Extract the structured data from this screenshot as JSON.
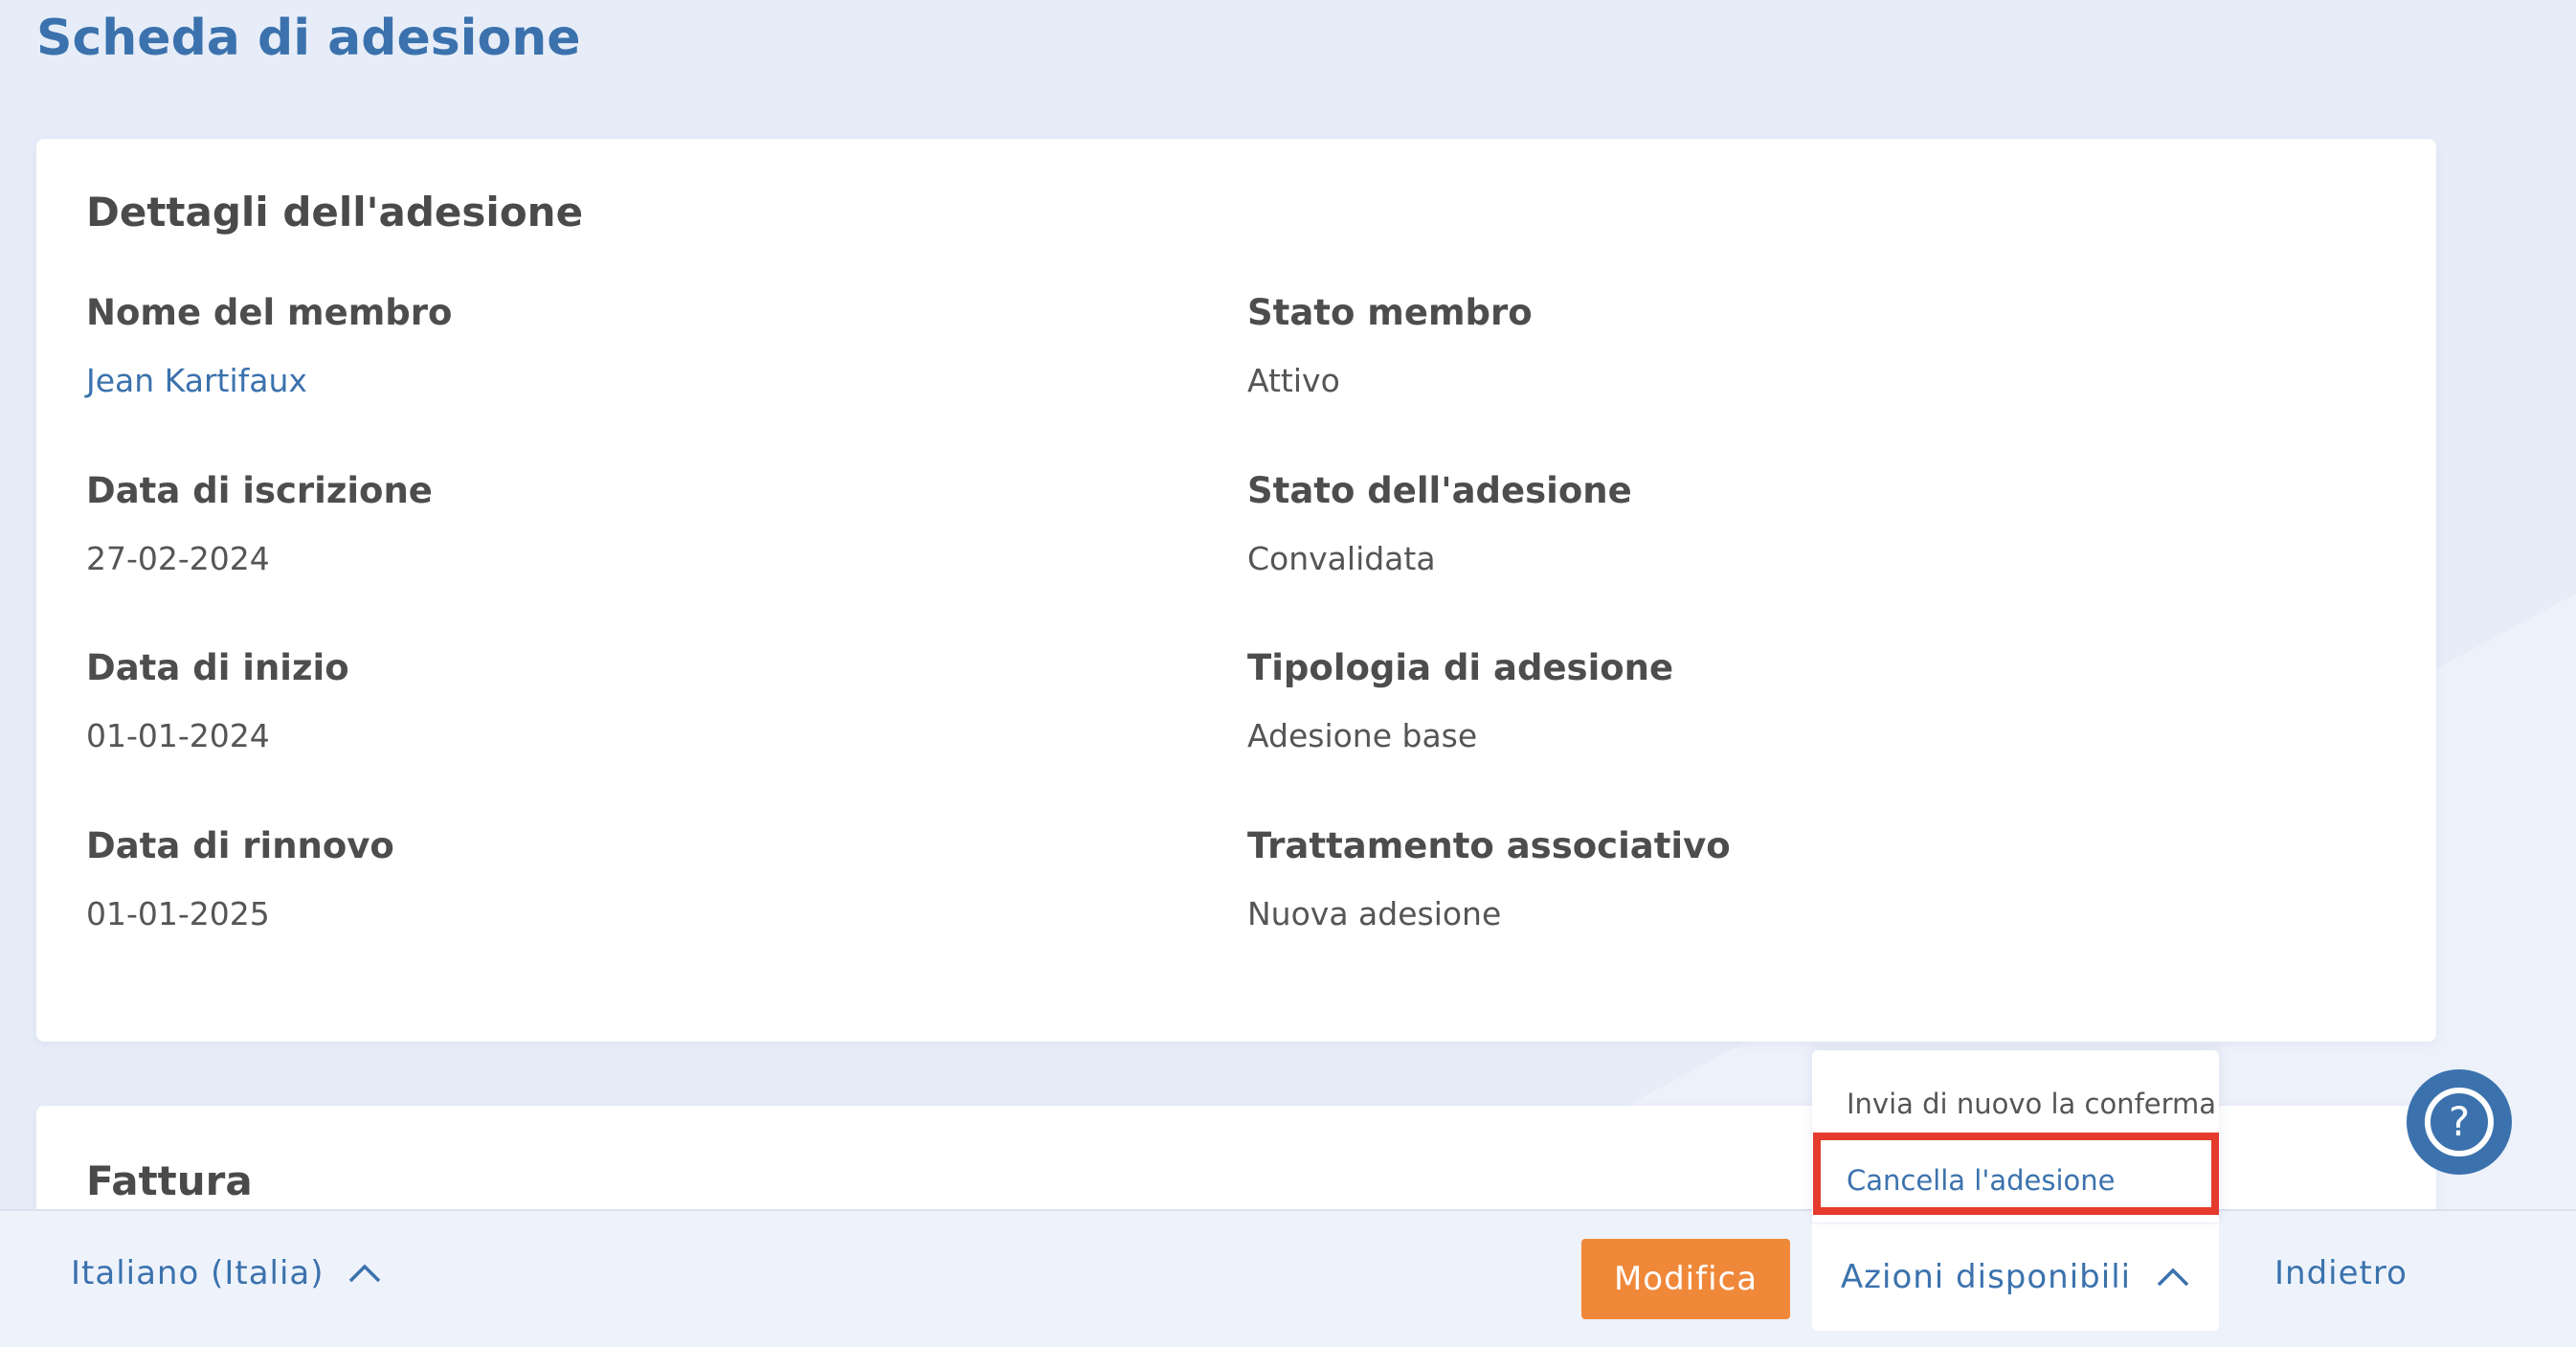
{
  "page": {
    "title": "Scheda di adesione"
  },
  "details": {
    "title": "Dettagli dell'adesione",
    "fields": [
      {
        "label": "Nome del membro",
        "value": "Jean Kartifaux"
      },
      {
        "label": "Stato membro",
        "value": "Attivo"
      },
      {
        "label": "Data di iscrizione",
        "value": "27-02-2024"
      },
      {
        "label": "Stato dell'adesione",
        "value": "Convalidata"
      },
      {
        "label": "Data di inizio",
        "value": "01-01-2024"
      },
      {
        "label": "Tipologia di adesione",
        "value": "Adesione base"
      },
      {
        "label": "Data di rinnovo",
        "value": "01-01-2025"
      },
      {
        "label": "Trattamento associativo",
        "value": "Nuova adesione"
      }
    ]
  },
  "invoice": {
    "title": "Fattura"
  },
  "footer": {
    "language": "Italiano (Italia)",
    "edit_label": "Modifica",
    "actions_label": "Azioni disponibili",
    "back_label": "Indietro"
  },
  "actions_menu": {
    "items": [
      {
        "label": "Invia di nuovo la conferma"
      },
      {
        "label": "Cancella l'adesione",
        "highlighted": true
      }
    ]
  },
  "colors": {
    "accent": "#3b72ad",
    "primary_button": "#f0883a",
    "highlight_box": "#e53b2c",
    "background": "#e7edf8"
  },
  "icons": {
    "language_chevron": "chevron-up-icon",
    "actions_chevron": "chevron-up-icon",
    "help": "question-circle-icon"
  }
}
